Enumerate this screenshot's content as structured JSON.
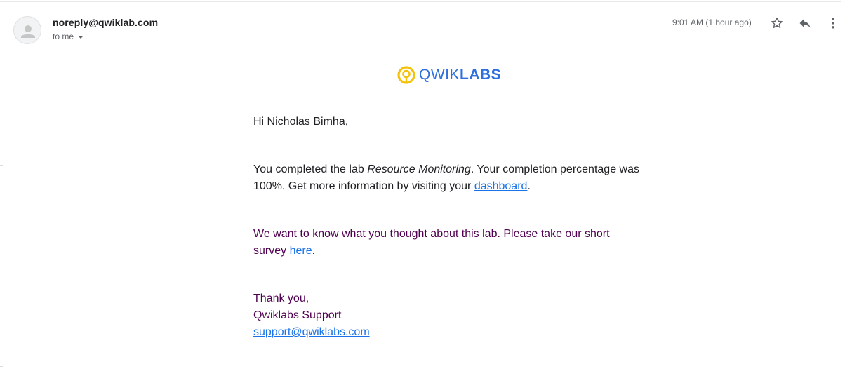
{
  "header": {
    "sender": "noreply@qwiklab.com",
    "recipient_label": "to me",
    "timestamp": "9:01 AM (1 hour ago)"
  },
  "icons": {
    "avatar": "person-icon",
    "star": "star-icon",
    "reply": "reply-icon",
    "more": "more-vert-icon",
    "logo_mark": "qwiklabs-logo-icon"
  },
  "logo": {
    "light": "QWIK",
    "bold": "LABS",
    "accent_color": "#f4c20d",
    "text_color": "#2f6fde"
  },
  "message": {
    "greeting": "Hi Nicholas Bimha,",
    "completed_prefix": "You completed the lab ",
    "lab_name": "Resource Monitoring",
    "completed_mid": ". Your completion percentage was",
    "completed_line2": "100%. Get more information by visiting your ",
    "dashboard_link": "dashboard",
    "period": ".",
    "survey_line1": "We want to know what you thought about this lab. Please take our short",
    "survey_prefix": "survey ",
    "survey_link": "here",
    "thanks": "Thank you,",
    "signature": "Qwiklabs Support",
    "support_email": "support@qwiklabs.com"
  },
  "colors": {
    "link": "#1a73e8",
    "quoted_text": "#500050",
    "muted": "#5f6368"
  }
}
